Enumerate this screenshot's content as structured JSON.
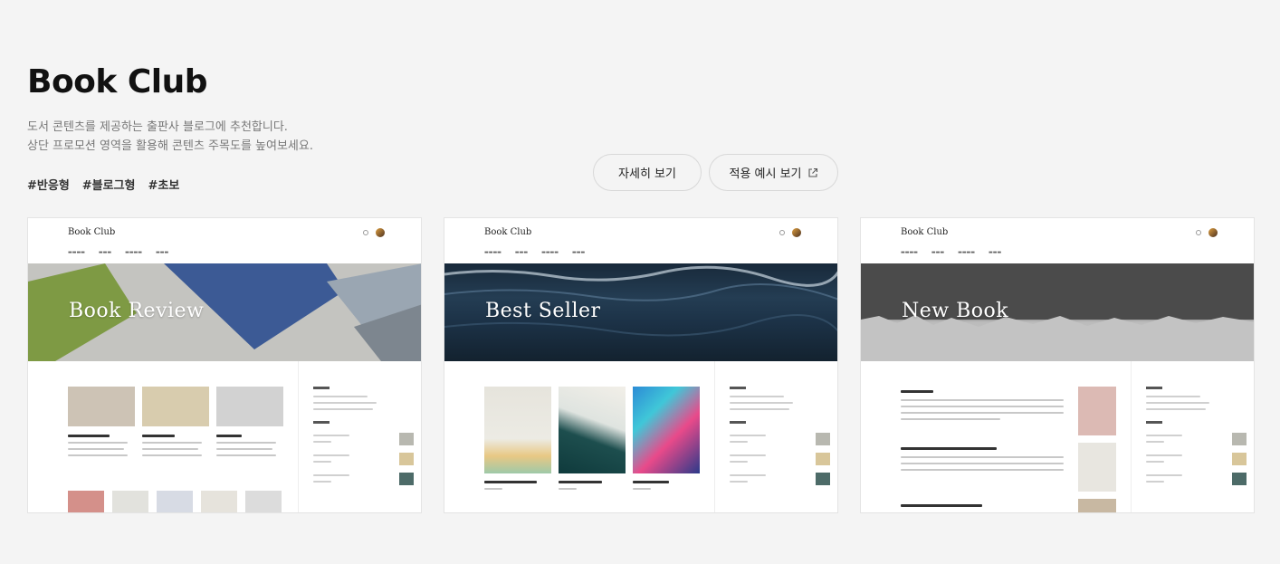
{
  "header": {
    "title": "Book Club",
    "desc_line1": "도서 콘텐츠를 제공하는 출판사 블로그에 추천합니다.",
    "desc_line2": "상단 프로모션 영역을 활용해 콘텐츠 주목도를 높여보세요.",
    "tags": [
      "#반응형",
      "#블로그형",
      "#초보"
    ]
  },
  "buttons": {
    "details_label": "자세히 보기",
    "preview_label": "적용 예시 보기"
  },
  "cards": [
    {
      "logo": "Book Club",
      "banner_title": "Book Review"
    },
    {
      "logo": "Book Club",
      "banner_title": "Best Seller"
    },
    {
      "logo": "Book Club",
      "banner_title": "New Book"
    }
  ],
  "colors": {
    "background": "#f4f4f4",
    "text_primary": "#111111",
    "text_secondary": "#777777",
    "button_border": "#d8d8d8"
  },
  "icons": [
    "external-link-icon",
    "search-icon",
    "avatar"
  ]
}
